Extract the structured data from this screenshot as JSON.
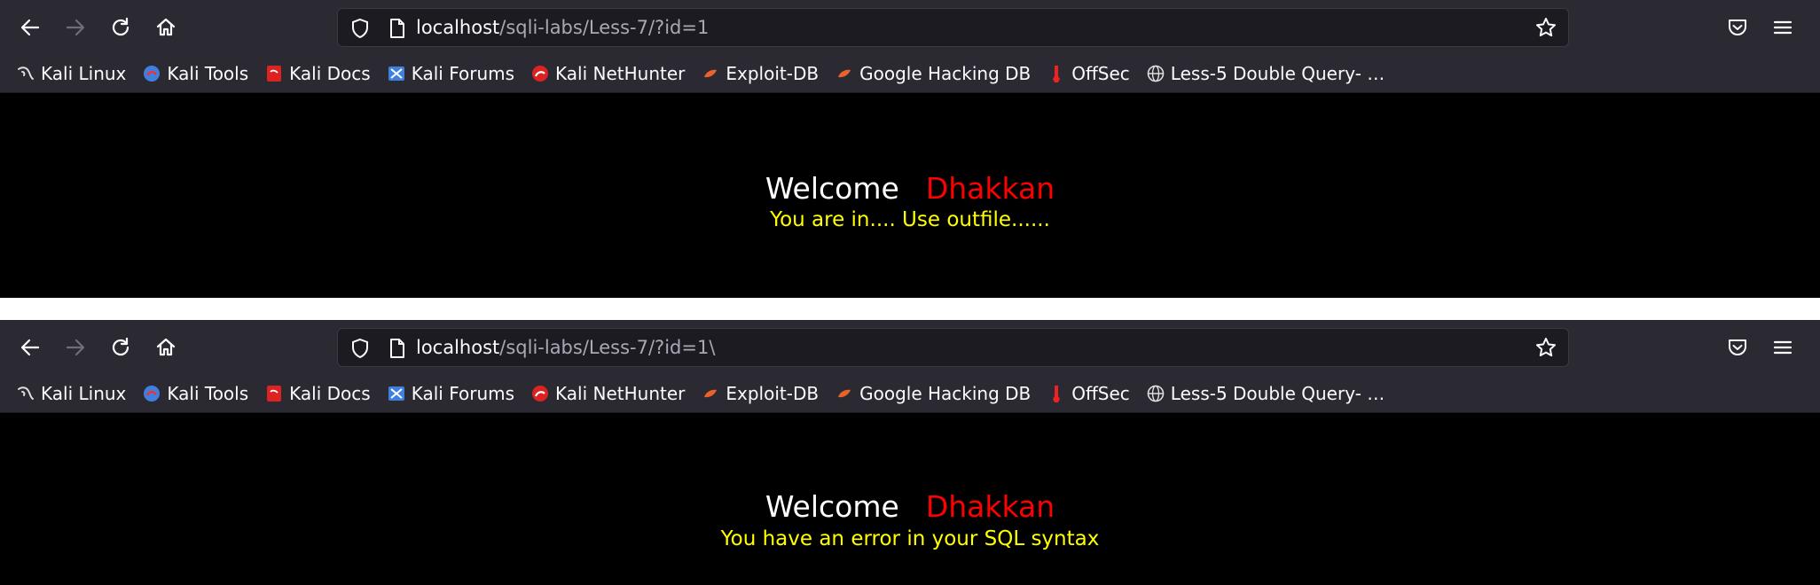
{
  "windows": [
    {
      "url_host": "localhost",
      "url_path": "/sqli-labs/Less-7/?id=1",
      "welcome": "Welcome",
      "name": "Dhakkan",
      "message": "You are in.... Use outfile......"
    },
    {
      "url_host": "localhost",
      "url_path": "/sqli-labs/Less-7/?id=1\\",
      "welcome": "Welcome",
      "name": "Dhakkan",
      "message": "You have an error in your SQL syntax"
    }
  ],
  "bookmarks": [
    {
      "label": "Kali Linux",
      "icon": "kali-dragon-icon"
    },
    {
      "label": "Kali Tools",
      "icon": "kali-tools-icon"
    },
    {
      "label": "Kali Docs",
      "icon": "kali-docs-icon"
    },
    {
      "label": "Kali Forums",
      "icon": "kali-forums-icon"
    },
    {
      "label": "Kali NetHunter",
      "icon": "kali-nethunter-icon"
    },
    {
      "label": "Exploit-DB",
      "icon": "exploit-db-icon"
    },
    {
      "label": "Google Hacking DB",
      "icon": "ghdb-icon"
    },
    {
      "label": "OffSec",
      "icon": "offsec-icon"
    },
    {
      "label": "Less-5 Double Query- …",
      "icon": "globe-icon"
    }
  ],
  "colors": {
    "toolbar": "#2b2a33",
    "page_bg": "#000000",
    "welcome": "#ffffff",
    "name": "#ff0000",
    "message": "#ffff00"
  }
}
